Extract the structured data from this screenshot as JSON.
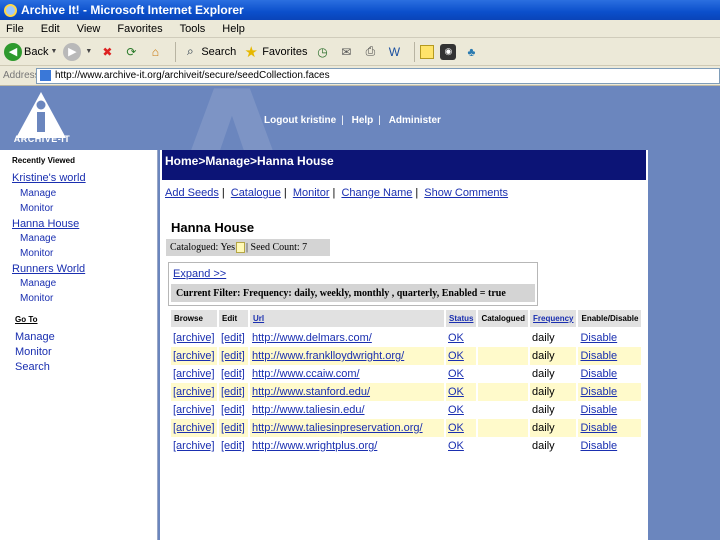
{
  "window": {
    "title": "Archive It! - Microsoft Internet Explorer"
  },
  "menu": [
    "File",
    "Edit",
    "View",
    "Favorites",
    "Tools",
    "Help"
  ],
  "toolbar": {
    "back": "Back",
    "search": "Search",
    "favorites": "Favorites"
  },
  "address": {
    "label": "Address",
    "url": "http://www.archive-it.org/archiveit/secure/seedCollection.faces"
  },
  "logo": {
    "text": "ARCHIVE-IT"
  },
  "topnav": [
    "Logout kristine",
    "Help",
    "Administer"
  ],
  "sidebar": {
    "recently_viewed": "Recently Viewed",
    "collections": [
      {
        "name": "Kristine's world",
        "links": [
          "Manage",
          "Monitor"
        ]
      },
      {
        "name": "Hanna House",
        "links": [
          "Manage",
          "Monitor"
        ]
      },
      {
        "name": "Runners World",
        "links": [
          "Manage",
          "Monitor"
        ]
      }
    ],
    "goto": "Go To",
    "goto_links": [
      "Manage",
      "Monitor",
      "Search"
    ]
  },
  "main": {
    "breadcrumb": "Home>Manage>Hanna House",
    "actions": [
      "Add Seeds",
      "Catalogue",
      "Monitor",
      "Change Name",
      "Show Comments"
    ],
    "collection_title": "Hanna House",
    "catalogued_label": "Catalogued: Yes",
    "seed_count": "| Seed Count: 7",
    "expand": "Expand >>",
    "current_filter": "Current Filter: Frequency: daily, weekly, monthly , quarterly, Enabled = true",
    "table": {
      "headers": [
        "Browse",
        "Edit",
        "Url",
        "Status",
        "Catalogued",
        "Frequency",
        "Enable/Disable"
      ],
      "rows": [
        {
          "browse": "[archive]",
          "edit": "[edit]",
          "url": "http://www.delmars.com/",
          "status": "OK",
          "catalogued": "",
          "frequency": "daily",
          "action": "Disable"
        },
        {
          "browse": "[archive]",
          "edit": "[edit]",
          "url": "http://www.franklloydwright.org/",
          "status": "OK",
          "catalogued": "",
          "frequency": "daily",
          "action": "Disable"
        },
        {
          "browse": "[archive]",
          "edit": "[edit]",
          "url": "http://www.ccaiw.com/",
          "status": "OK",
          "catalogued": "",
          "frequency": "daily",
          "action": "Disable"
        },
        {
          "browse": "[archive]",
          "edit": "[edit]",
          "url": "http://www.stanford.edu/",
          "status": "OK",
          "catalogued": "",
          "frequency": "daily",
          "action": "Disable"
        },
        {
          "browse": "[archive]",
          "edit": "[edit]",
          "url": "http://www.taliesin.edu/",
          "status": "OK",
          "catalogued": "",
          "frequency": "daily",
          "action": "Disable"
        },
        {
          "browse": "[archive]",
          "edit": "[edit]",
          "url": "http://www.taliesinpreservation.org/",
          "status": "OK",
          "catalogued": "",
          "frequency": "daily",
          "action": "Disable"
        },
        {
          "browse": "[archive]",
          "edit": "[edit]",
          "url": "http://www.wrightplus.org/",
          "status": "OK",
          "catalogued": "",
          "frequency": "daily",
          "action": "Disable"
        }
      ]
    }
  },
  "colors": {
    "nav_blue": "#0c1476",
    "page_bg": "#6b86be",
    "link": "#1a2fb0",
    "row_highlight": "#fffacb"
  }
}
